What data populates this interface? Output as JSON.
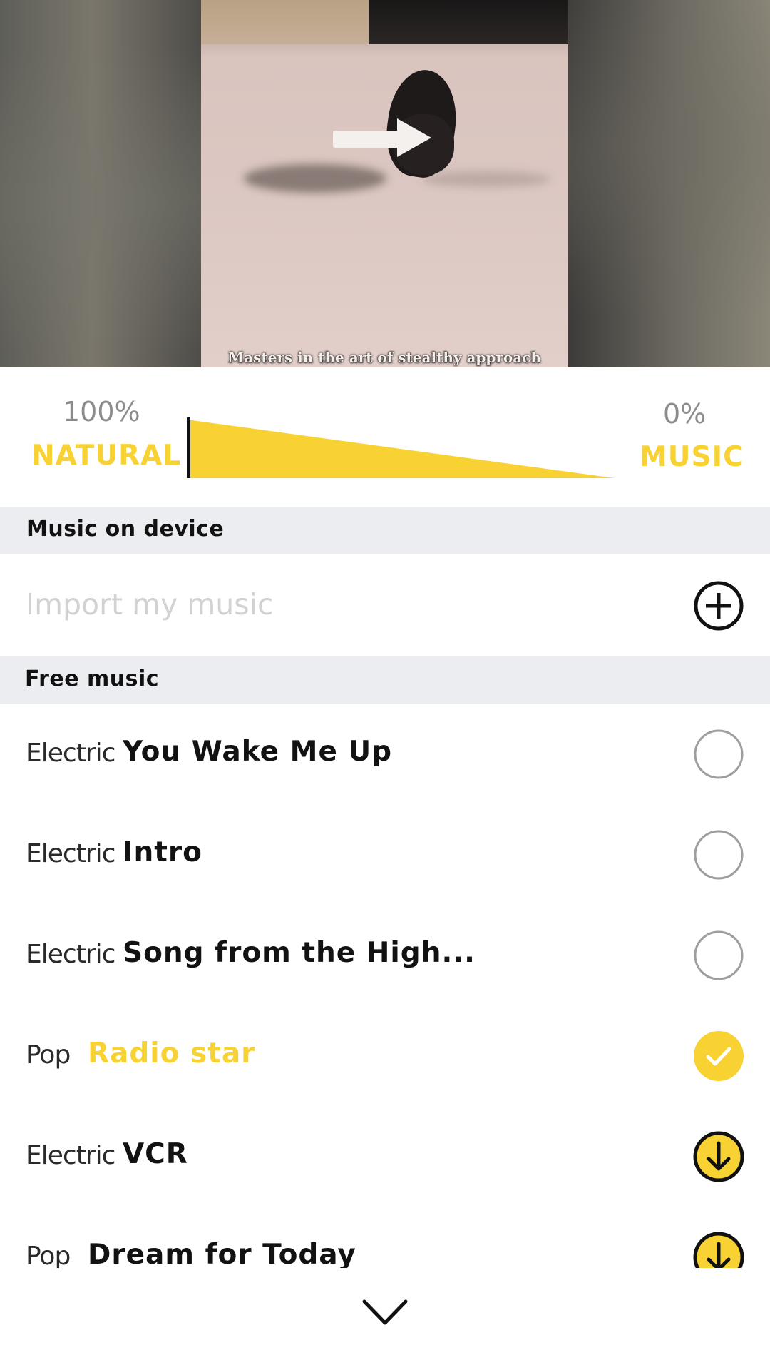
{
  "preview": {
    "caption": "Masters in the art of stealthy approach"
  },
  "mix": {
    "natural_percent_text": "100%",
    "natural_label": "NATURAL",
    "music_percent_text": "0%",
    "music_label": "MUSIC",
    "natural_level": 1.0,
    "music_level": 0.0,
    "accent_color": "#F8D232"
  },
  "device_section": {
    "header": "Music on device",
    "import_placeholder": "Import my music",
    "add_icon": "plus-circle-icon"
  },
  "free_section": {
    "header": "Free music",
    "tracks": [
      {
        "genre": "Electric",
        "title": "You Wake Me Up",
        "state": "unselected",
        "icon": "empty-circle-icon"
      },
      {
        "genre": "Electric",
        "title": "Intro",
        "state": "unselected",
        "icon": "empty-circle-icon"
      },
      {
        "genre": "Electric",
        "title": "Song from the High...",
        "state": "unselected",
        "icon": "empty-circle-icon"
      },
      {
        "genre": "Pop",
        "title": "Radio star",
        "state": "selected",
        "icon": "check-circle-icon"
      },
      {
        "genre": "Electric",
        "title": "VCR",
        "state": "download",
        "icon": "download-icon"
      },
      {
        "genre": "Pop",
        "title": "Dream for Today",
        "state": "download",
        "icon": "download-icon"
      }
    ]
  },
  "bottom": {
    "collapse_icon": "chevron-down-icon"
  }
}
